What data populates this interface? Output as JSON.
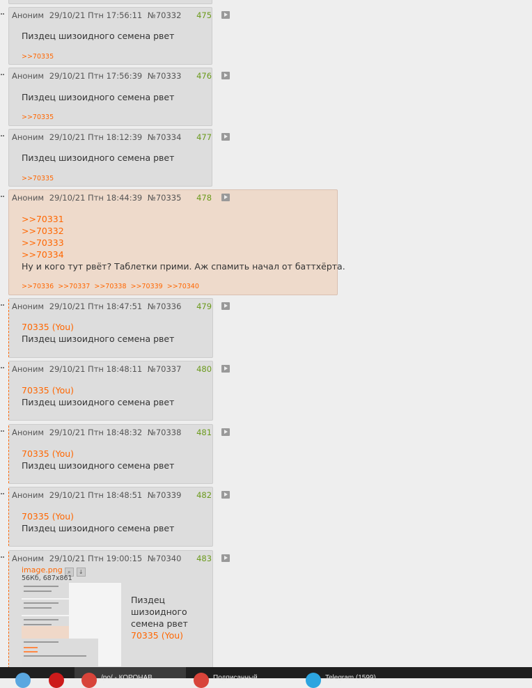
{
  "posts": [
    {
      "name": "Аноним",
      "date": "29/10/21 Птн 17:56:11",
      "num": "№70332",
      "count": "475",
      "text": "Пиздец шизоидного семена рвет",
      "backlinks": [
        ">>70335"
      ]
    },
    {
      "name": "Аноним",
      "date": "29/10/21 Птн 17:56:39",
      "num": "№70333",
      "count": "476",
      "text": "Пиздец шизоидного семена рвет",
      "backlinks": [
        ">>70335"
      ]
    },
    {
      "name": "Аноним",
      "date": "29/10/21 Птн 18:12:39",
      "num": "№70334",
      "count": "477",
      "text": "Пиздец шизоидного семена рвет",
      "backlinks": [
        ">>70335"
      ]
    },
    {
      "name": "Аноним",
      "date": "29/10/21 Птн 18:44:39",
      "num": "№70335",
      "count": "478",
      "links": [
        ">>70331",
        ">>70332",
        ">>70333",
        ">>70334"
      ],
      "text": "Ну и кого тут рвёт? Таблетки прими. Аж спамить начал от баттхёрта.",
      "backlinks": [
        ">>70336",
        ">>70337",
        ">>70338",
        ">>70339",
        ">>70340"
      ]
    },
    {
      "name": "Аноним",
      "date": "29/10/21 Птн 18:47:51",
      "num": "№70336",
      "count": "479",
      "quote": "70335 (You)",
      "text": "Пиздец шизоидного семена рвет"
    },
    {
      "name": "Аноним",
      "date": "29/10/21 Птн 18:48:11",
      "num": "№70337",
      "count": "480",
      "quote": "70335 (You)",
      "text": "Пиздец шизоидного семена рвет"
    },
    {
      "name": "Аноним",
      "date": "29/10/21 Птн 18:48:32",
      "num": "№70338",
      "count": "481",
      "quote": "70335 (You)",
      "text": "Пиздец шизоидного семена рвет"
    },
    {
      "name": "Аноним",
      "date": "29/10/21 Птн 18:48:51",
      "num": "№70339",
      "count": "482",
      "quote": "70335 (You)",
      "text": "Пиздец шизоидного семена рвет"
    },
    {
      "name": "Аноним",
      "date": "29/10/21 Птн 19:00:15",
      "num": "№70340",
      "count": "483",
      "file": {
        "name": "image.png",
        "info": "56Кб, 687x861"
      },
      "text_lines": [
        "Пиздец",
        "шизоидного",
        "семена рвет"
      ],
      "quote": "70335 (You)"
    }
  ],
  "taskbar": {
    "items": [
      {
        "icon": "browser-icon",
        "label": ""
      },
      {
        "icon": "opera-icon",
        "label": ""
      },
      {
        "icon": "chrome-tab-icon",
        "label": "/po/ - КОРОНАВ..."
      },
      {
        "icon": "chrome-tab-icon",
        "label": "Подписанный..."
      },
      {
        "icon": "telegram-icon",
        "label": "Telegram (1599)"
      }
    ]
  },
  "colors": {
    "link": "#ff6600",
    "count": "#6b9a1c",
    "post_bg": "#dddddd",
    "highlight_bg": "#eedacb",
    "page_bg": "#eeeeee"
  }
}
